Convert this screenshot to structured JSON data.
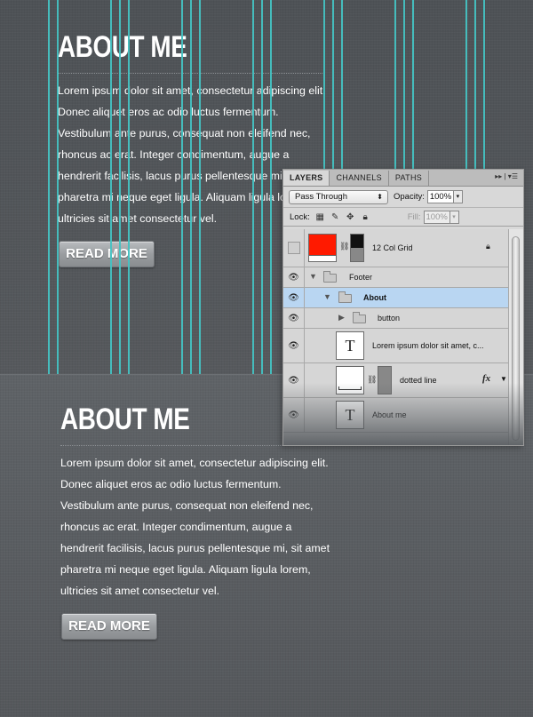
{
  "top_section": {
    "heading": "ABOUT ME",
    "body": "Lorem ipsum dolor sit amet, consectetur adipiscing elit. Donec aliquet eros ac odio luctus fermentum. Vestibulum ante purus, consequat non eleifend nec, rhoncus ac erat. Integer condimentum, augue a hendrerit facilisis, lacus purus pellentesque mi, sit amet pharetra mi neque eget ligula. Aliquam ligula lorem, ultricies sit amet consectetur vel.",
    "button_label": "READ MORE"
  },
  "bottom_section": {
    "heading": "ABOUT ME",
    "body": "Lorem ipsum dolor sit amet, consectetur adipiscing elit. Donec aliquet eros ac odio luctus fermentum. Vestibulum ante purus, consequat non eleifend nec, rhoncus ac erat. Integer condimentum, augue a hendrerit facilisis, lacus purus pellentesque mi, sit amet pharetra mi neque eget ligula. Aliquam ligula lorem, ultricies sit amet consectetur vel.",
    "button_label": "READ MORE"
  },
  "guide_color": "#44c2c2",
  "layers_panel": {
    "tabs": [
      "LAYERS",
      "CHANNELS",
      "PATHS"
    ],
    "active_tab": "LAYERS",
    "blend_mode": "Pass Through",
    "opacity_label": "Opacity:",
    "opacity_value": "100%",
    "lock_label": "Lock:",
    "fill_label": "Fill:",
    "fill_value": "100%",
    "layers": [
      {
        "name": "12 Col Grid",
        "visible": false,
        "locked": true,
        "type": "fill"
      },
      {
        "name": "Footer",
        "visible": true,
        "type": "folder",
        "expanded": true
      },
      {
        "name": "About",
        "visible": true,
        "type": "folder",
        "expanded": true,
        "selected": true
      },
      {
        "name": "button",
        "visible": true,
        "type": "folder",
        "expanded": false
      },
      {
        "name": "Lorem ipsum dolor sit amet, c...",
        "visible": true,
        "type": "text"
      },
      {
        "name": "dotted line",
        "visible": true,
        "type": "shape",
        "has_fx": true
      },
      {
        "name": "About me",
        "visible": true,
        "type": "text"
      }
    ],
    "fill_swatch_color": "#ff1a00"
  }
}
